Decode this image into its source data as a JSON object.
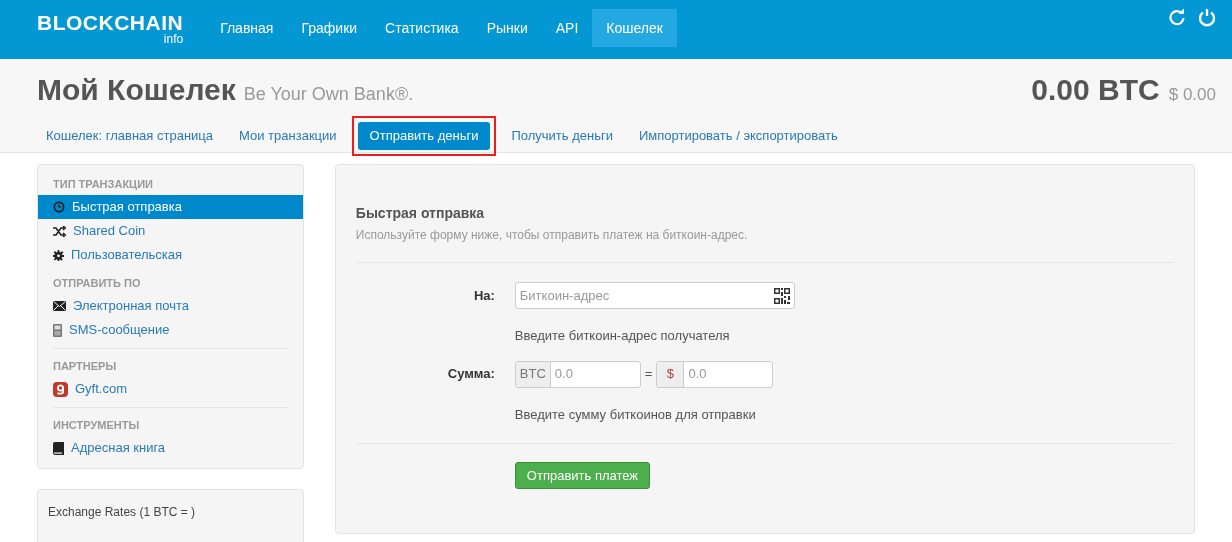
{
  "header": {
    "logo": "BLOCKCHAIN",
    "logo_sub": "info",
    "nav": [
      {
        "label": "Главная",
        "selected": false
      },
      {
        "label": "Графики",
        "selected": false
      },
      {
        "label": "Статистика",
        "selected": false
      },
      {
        "label": "Рынки",
        "selected": false
      },
      {
        "label": "API",
        "selected": false
      },
      {
        "label": "Кошелек",
        "selected": true
      }
    ]
  },
  "title": "Мой Кошелек",
  "tagline": "Be Your Own Bank®.",
  "balance": "0.00 BTC",
  "balance_usd": "$ 0.00",
  "tabs": [
    {
      "label": "Кошелек: главная страница",
      "selected": false,
      "highlighted": false
    },
    {
      "label": "Мои транзакции",
      "selected": false,
      "highlighted": false
    },
    {
      "label": "Отправить деньги",
      "selected": true,
      "highlighted": true
    },
    {
      "label": "Получить деньги",
      "selected": false,
      "highlighted": false
    },
    {
      "label": "Импортировать / экспортировать",
      "selected": false,
      "highlighted": false
    }
  ],
  "sidebar": {
    "sections": [
      {
        "heading": "ТИП ТРАНЗАКЦИИ",
        "items": [
          {
            "label": "Быстрая отправка",
            "kind": "clock",
            "selected": true
          },
          {
            "label": "Shared Coin",
            "kind": "shuffle",
            "selected": false
          },
          {
            "label": "Пользовательская",
            "kind": "gear",
            "selected": false
          }
        ]
      },
      {
        "heading": "ОТПРАВИТЬ ПО",
        "items": [
          {
            "label": "Электронная почта",
            "kind": "envelope",
            "selected": false
          },
          {
            "label": "SMS-сообщение",
            "kind": "phone",
            "selected": false
          }
        ]
      },
      {
        "heading": "ПАРТНЕРЫ",
        "items": [
          {
            "label": "Gyft.com",
            "kind": "gyft",
            "selected": false
          }
        ]
      },
      {
        "heading": "ИНСТРУМЕНТЫ",
        "items": [
          {
            "label": "Адресная книга",
            "kind": "book",
            "selected": false
          }
        ]
      }
    ]
  },
  "exchange_rates": {
    "title": "Exchange Rates (1 BTC = )"
  },
  "form": {
    "title": "Быстрая отправка",
    "subtitle": "Используйте форму ниже, чтобы отправить платеж на биткоин-адрес.",
    "to_label": "На:",
    "to_placeholder": "Биткоин-адрес",
    "to_help": "Введите биткоин-адрес получателя",
    "amount_label": "Сумма:",
    "btc_addon": "BTC",
    "btc_placeholder": "0.0",
    "equals": "=",
    "usd_addon": "$",
    "usd_placeholder": "0.0",
    "amount_help": "Введите сумму биткоинов для отправки",
    "submit": "Отправить платеж"
  }
}
